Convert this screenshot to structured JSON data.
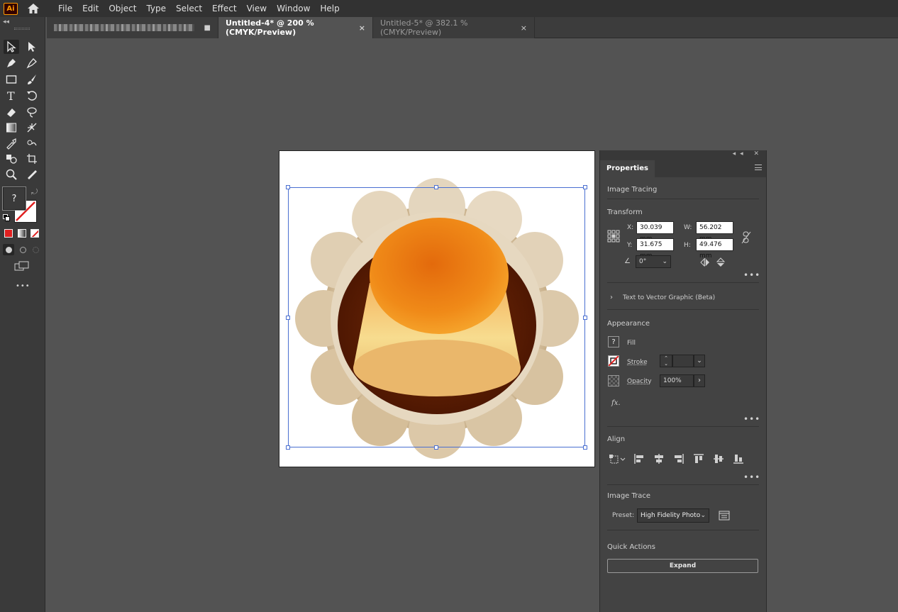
{
  "app": {
    "logo": "Ai",
    "menu": [
      "File",
      "Edit",
      "Object",
      "Type",
      "Select",
      "Effect",
      "View",
      "Window",
      "Help"
    ]
  },
  "tabs": [
    {
      "label": "",
      "blurred": true
    },
    {
      "label": "Untitled-4* @ 200 % (CMYK/Preview)",
      "active": true,
      "close": "×"
    },
    {
      "label": "Untitled-5* @ 382.1 % (CMYK/Preview)",
      "active": false,
      "close": "×"
    }
  ],
  "toolbar": {
    "fill_swatch_label": "?",
    "more": "•••",
    "icons": [
      "selection-tool-icon",
      "direct-selection-tool-icon",
      "pen-tool-icon",
      "curvature-tool-icon",
      "rectangle-tool-icon",
      "paintbrush-tool-icon",
      "type-tool-icon",
      "rotate-tool-icon",
      "eraser-tool-icon",
      "lasso-tool-icon",
      "gradient-tool-icon",
      "eyedropper-tool-icon",
      "zoom-tool-icon",
      "artboard-tool-icon"
    ]
  },
  "properties": {
    "tab_label": "Properties",
    "image_tracing": "Image Tracing",
    "transform": {
      "title": "Transform",
      "x_label": "X:",
      "x_value": "30.039 mm",
      "y_label": "Y:",
      "y_value": "31.675 mm",
      "w_label": "W:",
      "w_value": "56.202 mm",
      "h_label": "H:",
      "h_value": "49.476 mm",
      "angle_value": "0°"
    },
    "text_to_vector": "Text to Vector Graphic (Beta)",
    "appearance": {
      "title": "Appearance",
      "fill_label": "Fill",
      "fill_swatch": "?",
      "stroke_label": "Stroke",
      "opacity_label": "Opacity",
      "opacity_value": "100%",
      "fx_label": "fx."
    },
    "align": {
      "title": "Align"
    },
    "image_trace": {
      "title": "Image Trace",
      "preset_label": "Preset:",
      "preset_value": "High Fidelity Photo"
    },
    "quick_actions": {
      "title": "Quick Actions",
      "expand_label": "Expand"
    },
    "more": "•••"
  },
  "colors": {
    "accent_selection": "#4a6fd1",
    "app_bg": "#535353",
    "panel_bg": "#434343",
    "logo_orange": "#ff9a00"
  }
}
